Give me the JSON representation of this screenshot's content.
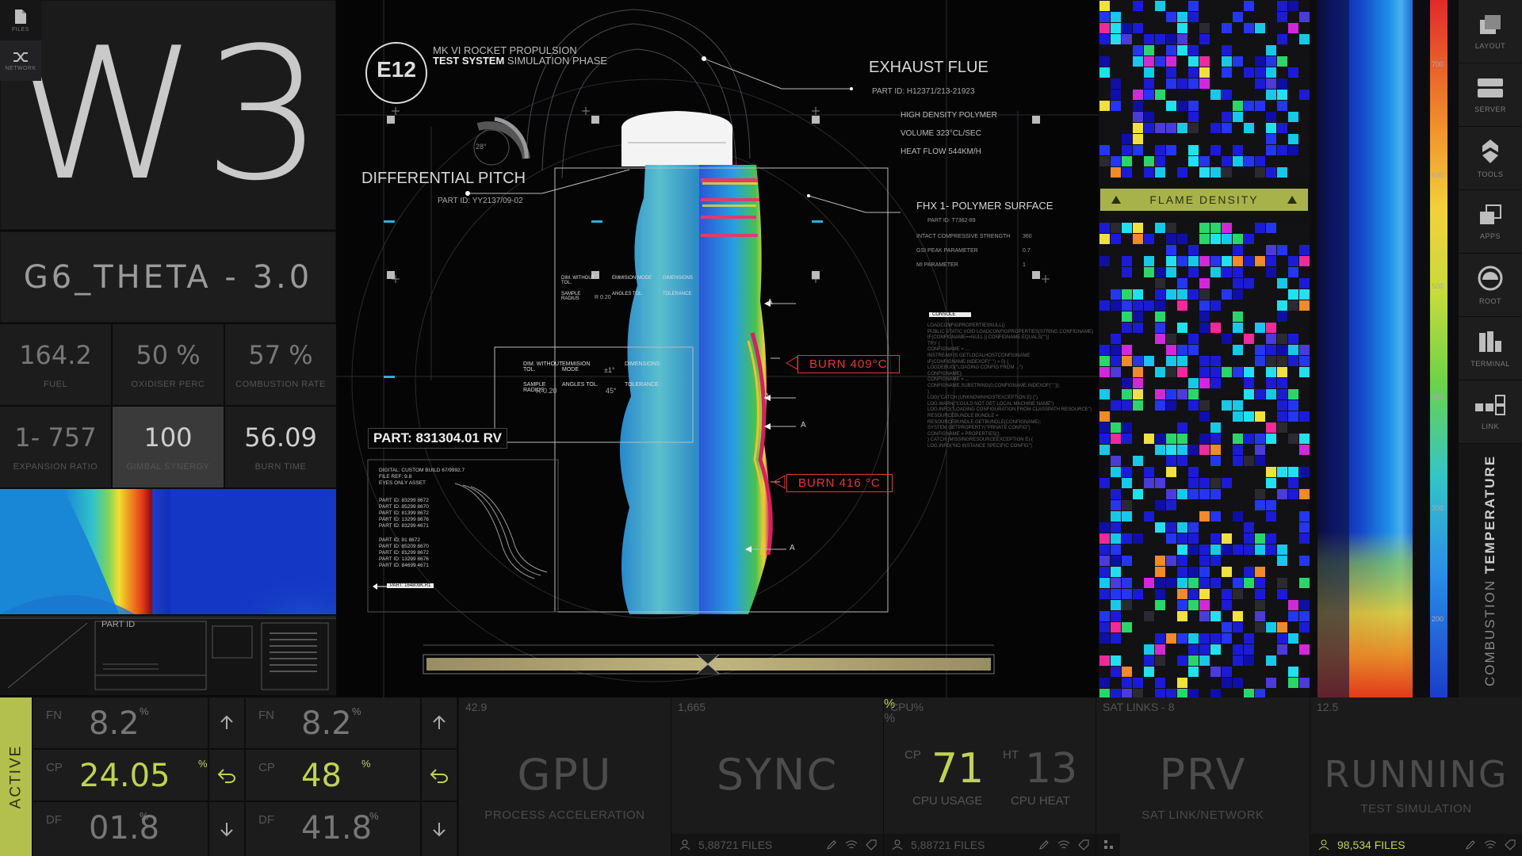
{
  "left_tools": [
    {
      "label": "FILES",
      "icon": "file-icon"
    },
    {
      "label": "NETWORK",
      "icon": "network-icon"
    }
  ],
  "title": "W3",
  "theta": "G6_THETA  -  3.0",
  "stats": [
    {
      "value": "164.2",
      "label": "FUEL"
    },
    {
      "value": "50 %",
      "label": "OXIDISER PERC"
    },
    {
      "value": "57 %",
      "label": "COMBUSTION RATE"
    },
    {
      "value": "1- 757",
      "label": "EXPANSION RATIO"
    },
    {
      "value": "100",
      "label": "GIMBAL SYNERGY"
    },
    {
      "value": "56.09",
      "label": "BURN TIME"
    }
  ],
  "blueprint": {
    "title": "PART ID"
  },
  "center": {
    "badge": "E12",
    "header_line1": "MK VI ROCKET PROPULSION",
    "header_bold": "TEST SYSTEM",
    "header_rest": " SIMULATION PHASE",
    "diff_pitch": "DIFFERENTIAL PITCH",
    "diff_pitch_id": "PART ID: YY2137/09-02",
    "gauge_value": "28°",
    "exhaust_title": "EXHAUST FLUE",
    "exhaust_id": "PART ID: H12371/213-21923",
    "exhaust_specs": [
      "HIGH DENSITY POLYMER",
      "VOLUME 323°CL/SEC",
      "HEAT FLOW 544KM/H"
    ],
    "fhx_title": "FHX 1- POLYMER SURFACE",
    "fhx_id": "PART ID: T7362-89",
    "fhx_rows": [
      {
        "k": "INTACT COMPRESSIVE STRENGTH",
        "v": "360"
      },
      {
        "k": "GSI PEAK PARAMETER",
        "v": "0.7"
      },
      {
        "k": "MI PARAMETER",
        "v": "1"
      }
    ],
    "console_label": "CONSOLE",
    "console_lines": [
      "LOADCONFIGPROPERTIESNULL()",
      "PUBLIC STATIC VOID LOADCONFIGPROPERTIES(STRING CONFIGNAME)",
      "IF(CONFIGNAME==NULL || CONFIGNAME.EQUALS(\"\"))",
      "TRY {",
      "CONFIGNAME = ...",
      "INSTREAM IS GETLOCALHOSTCONFIGNAME",
      "IF(CONFIGNAME.INDEXOF(\".\") > 0) {",
      "LOGDEBUG(\"LOADING CONFIG FROM ...\")",
      "CONFIGNAME);",
      "CONFIGNAME = ...",
      "CONFIGNAME.SUBSTRING(0,CONFIGNAME.INDEXOF(\".\"));",
      "}",
      "LOG(\"CATCH (UNKNOWNHOSTEXCEPTION E) {\")",
      "LOG.WARN(\"COULD NOT GET LOCAL MACHINE NAME\")",
      "LOG.INFO(\"LOADING CONFIGURATION FROM CLASSPATH RESOURCE\")",
      "RESOURCEBUNDLE BUNDLE =",
      "RESOURCEBUNDLE.GETBUNDLE(CONFIGNAME);",
      "SYSTEM.GETPROPERTY(\"PRIVATE CONFIG\")",
      "CONFIGNAME = PROPERTIES();",
      "} CATCH (MISSINGRESOURCEEXCEPTION E) {",
      "LOG.INFO(\"NO INSTANCE SPECIFIC CONFIG\")"
    ],
    "burn1": "BURN    409°C",
    "burn2": "BURN    416 °C",
    "part_label": "PART: 831304.01 RV",
    "part_lines": [
      "DIGITAL: CUSTOM BUILD 67/9992.7",
      "FILE REF: 9.8",
      "EYES ONLY ASSET"
    ],
    "part_ids_a": [
      "PART ID: 83299 8672",
      "PART ID: 85299 8670",
      "PART ID: 81399 8672",
      "PART ID: 13299 8676",
      "PART ID: 83299 4671"
    ],
    "part_ids_b": [
      "PART ID: 81 8672",
      "PART ID: 85209 8670",
      "PART ID: 81299 8672",
      "PART ID: 13299 8676",
      "PART ID: 84699 4671"
    ],
    "part_tag": "PART: 164809K.R1",
    "dim_table": {
      "c1": "DIM. WITHOUT TOL.",
      "c2": "EMMISION MODE",
      "c3": "DIMENSIONS",
      "r1": "SAMPLE RADIUS",
      "r1v": "R 0.20",
      "r2": "ANGLES TOL.",
      "r2v": "±1°",
      "r3": "TOLERANCE",
      "r3v": "45°"
    },
    "marker": "A"
  },
  "flame_density": "FLAME DENSITY",
  "temp_scale": [
    "700",
    "600",
    "500",
    "400",
    "300",
    "200"
  ],
  "combustion_label": "COMBUSTION",
  "temperature_label": "TEMPERATURE",
  "right_nav": [
    {
      "label": "LAYOUT",
      "icon": "layout-icon"
    },
    {
      "label": "SERVER",
      "icon": "server-icon"
    },
    {
      "label": "TOOLS",
      "icon": "tools-icon"
    },
    {
      "label": "APPS",
      "icon": "apps-icon"
    },
    {
      "label": "ROOT",
      "icon": "root-icon"
    },
    {
      "label": "TERMINAL",
      "icon": "terminal-icon"
    },
    {
      "label": "LINK",
      "icon": "link-icon"
    }
  ],
  "bottom": {
    "active": "ACTIVE",
    "group1": {
      "fn_label": "FN",
      "fn": "8.2",
      "cp_label": "CP",
      "cp": "24.05",
      "df_label": "DF",
      "df": "01.8"
    },
    "group2": {
      "fn_label": "FN",
      "fn": "8.2",
      "cp_label": "CP",
      "cp": "48",
      "df_label": "DF",
      "df": "41.8"
    },
    "pct": "%",
    "gpu": {
      "num": "42.9",
      "big": "GPU",
      "sub": "PROCESS ACCELERATION"
    },
    "sync": {
      "num": "1,665",
      "big": "SYNC",
      "files": "5,88721 FILES"
    },
    "cpu": {
      "num": "CPU%",
      "cp_label": "CP",
      "cp": "71",
      "ht_label": "HT",
      "ht": "13",
      "usage": "CPU USAGE",
      "heat": "CPU HEAT",
      "files": "5,88721 FILES"
    },
    "prv": {
      "num": "SAT LINKS - 8",
      "big": "PRV",
      "sub": "SAT LINK/NETWORK"
    },
    "running": {
      "num": "12.5",
      "big": "RUNNING",
      "sub": "TEST SIMULATION",
      "files": "98,534 FILES"
    }
  }
}
